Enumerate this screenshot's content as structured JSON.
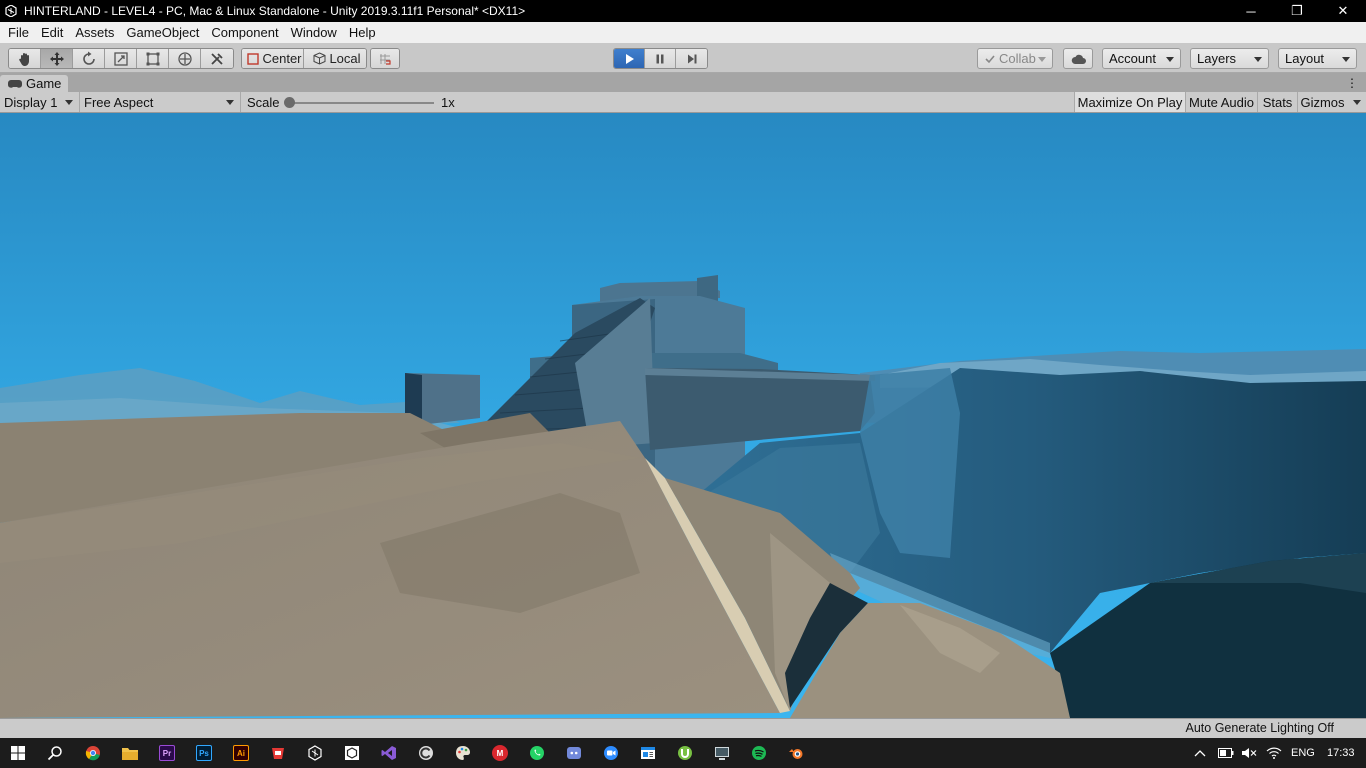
{
  "window": {
    "title": "HINTERLAND - LEVEL4 - PC, Mac & Linux Standalone - Unity 2019.3.11f1 Personal* <DX11>",
    "minimize": "─",
    "restore": "❐",
    "close": "✕"
  },
  "menu": [
    "File",
    "Edit",
    "Assets",
    "GameObject",
    "Component",
    "Window",
    "Help"
  ],
  "toolbar": {
    "tools": [
      "hand-tool-icon",
      "move-tool-icon",
      "rotate-tool-icon",
      "scale-tool-icon",
      "rect-tool-icon",
      "transform-tool-icon",
      "custom-tool-icon"
    ],
    "pivot_label": "Center",
    "space_label": "Local",
    "collab_label": "Collab",
    "account_label": "Account",
    "layers_label": "Layers",
    "layout_label": "Layout",
    "play_active": true
  },
  "game_tab": {
    "label": "Game"
  },
  "game_toolbar": {
    "display": "Display 1",
    "aspect": "Free Aspect",
    "scale_label": "Scale",
    "scale_value": "1x",
    "scale_fraction": 0.0,
    "maximize_on_play": "Maximize On Play",
    "mute_audio": "Mute Audio",
    "stats": "Stats",
    "gizmos": "Gizmos"
  },
  "statusbar": {
    "message": "Auto Generate Lighting Off"
  },
  "taskbar": {
    "apps": [
      "chrome-icon",
      "file-explorer-icon",
      "premiere-icon",
      "photoshop-icon",
      "illustrator-icon",
      "red-app-icon",
      "unity-icon",
      "unity-hub-icon",
      "visual-studio-icon",
      "ccleaner-icon",
      "paint-icon",
      "mega-icon",
      "whatsapp-icon",
      "discord-icon",
      "zoom-icon",
      "news-icon",
      "utorrent-icon",
      "remote-icon",
      "spotify-icon",
      "blender-icon"
    ],
    "app_labels": {
      "premiere": "Pr",
      "photoshop": "Ps",
      "illustrator": "Ai",
      "mega": "M"
    },
    "language": "ENG",
    "time": "17:33"
  },
  "colors": {
    "sky_top": "#2a8fc9",
    "sky_bottom": "#35aee8",
    "sand": "#8f8676",
    "structure": "#4a6e86",
    "play_accent": "#3a77c4"
  }
}
